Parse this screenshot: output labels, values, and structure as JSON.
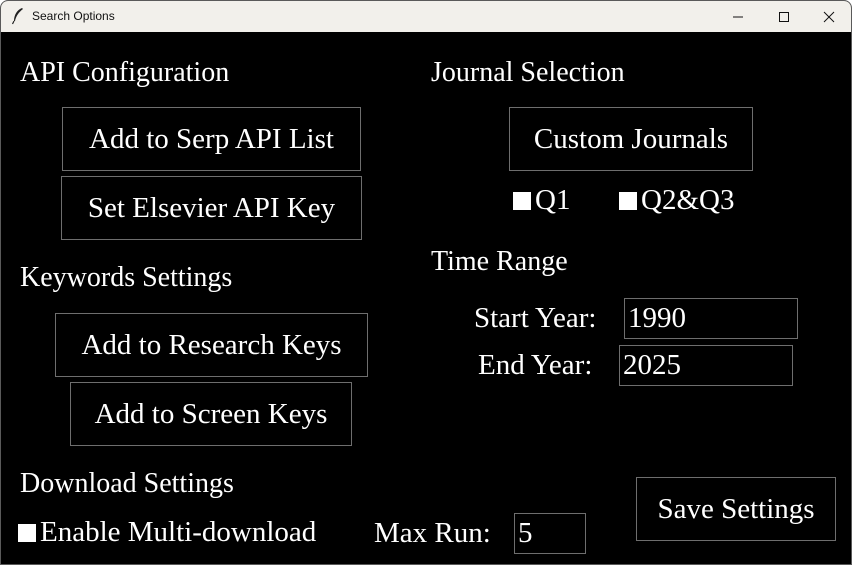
{
  "window": {
    "title": "Search Options"
  },
  "api": {
    "heading": "API Configuration",
    "serp_button": "Add to Serp API List",
    "elsevier_button": "Set Elsevier API Key"
  },
  "keywords": {
    "heading": "Keywords Settings",
    "research_button": "Add to Research Keys",
    "screen_button": "Add to Screen Keys"
  },
  "download": {
    "heading": "Download Settings",
    "multi_label": "Enable Multi-download",
    "max_run_label": "Max Run:",
    "max_run_value": "5"
  },
  "journal": {
    "heading": "Journal Selection",
    "custom_button": "Custom Journals",
    "q1_label": "Q1",
    "q2q3_label": "Q2&Q3"
  },
  "time": {
    "heading": "Time Range",
    "start_label": "Start Year:",
    "start_value": "1990",
    "end_label": "End Year:",
    "end_value": "2025"
  },
  "save_button": "Save Settings",
  "colors": {
    "background": "#000000",
    "text": "#ffffff",
    "border": "#6e6e6e",
    "titlebar": "#f2f0eb"
  }
}
